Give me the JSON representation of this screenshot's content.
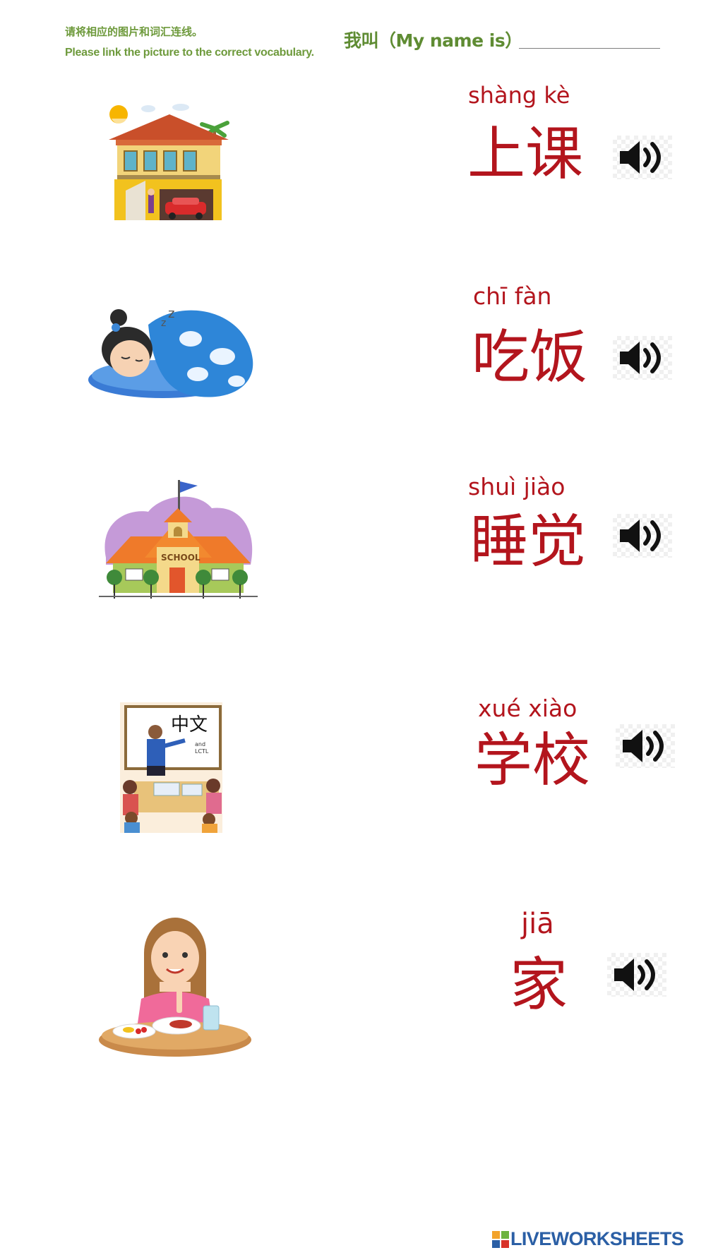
{
  "header": {
    "instruction_zh": "请将相应的图片和词汇连线。",
    "instruction_en": "Please link the picture to the correct vocabulary.",
    "name_label": "我叫（My name is）"
  },
  "vocabulary": [
    {
      "pinyin": "shàng   kè",
      "hanzi": "上课",
      "audio_icon": "speaker-icon"
    },
    {
      "pinyin": "chī   fàn",
      "hanzi": "吃饭",
      "audio_icon": "speaker-icon"
    },
    {
      "pinyin": "shuì  jiào",
      "hanzi": "睡觉",
      "audio_icon": "speaker-icon"
    },
    {
      "pinyin": "xué  xiào",
      "hanzi": "学校",
      "audio_icon": "speaker-icon"
    },
    {
      "pinyin": "jiā",
      "hanzi": "家",
      "audio_icon": "speaker-icon"
    }
  ],
  "pictures": {
    "classroom_board_text": "中文",
    "classroom_board_small": "and",
    "classroom_board_small2": "LCTL",
    "school_sign": "SCHOOL"
  },
  "footer": {
    "brand": "LIVEWORKSHEETS"
  },
  "colors": {
    "instruction_green": "#6e9a3c",
    "vocab_red": "#b3151d",
    "brand_blue": "#2b5fa5"
  }
}
